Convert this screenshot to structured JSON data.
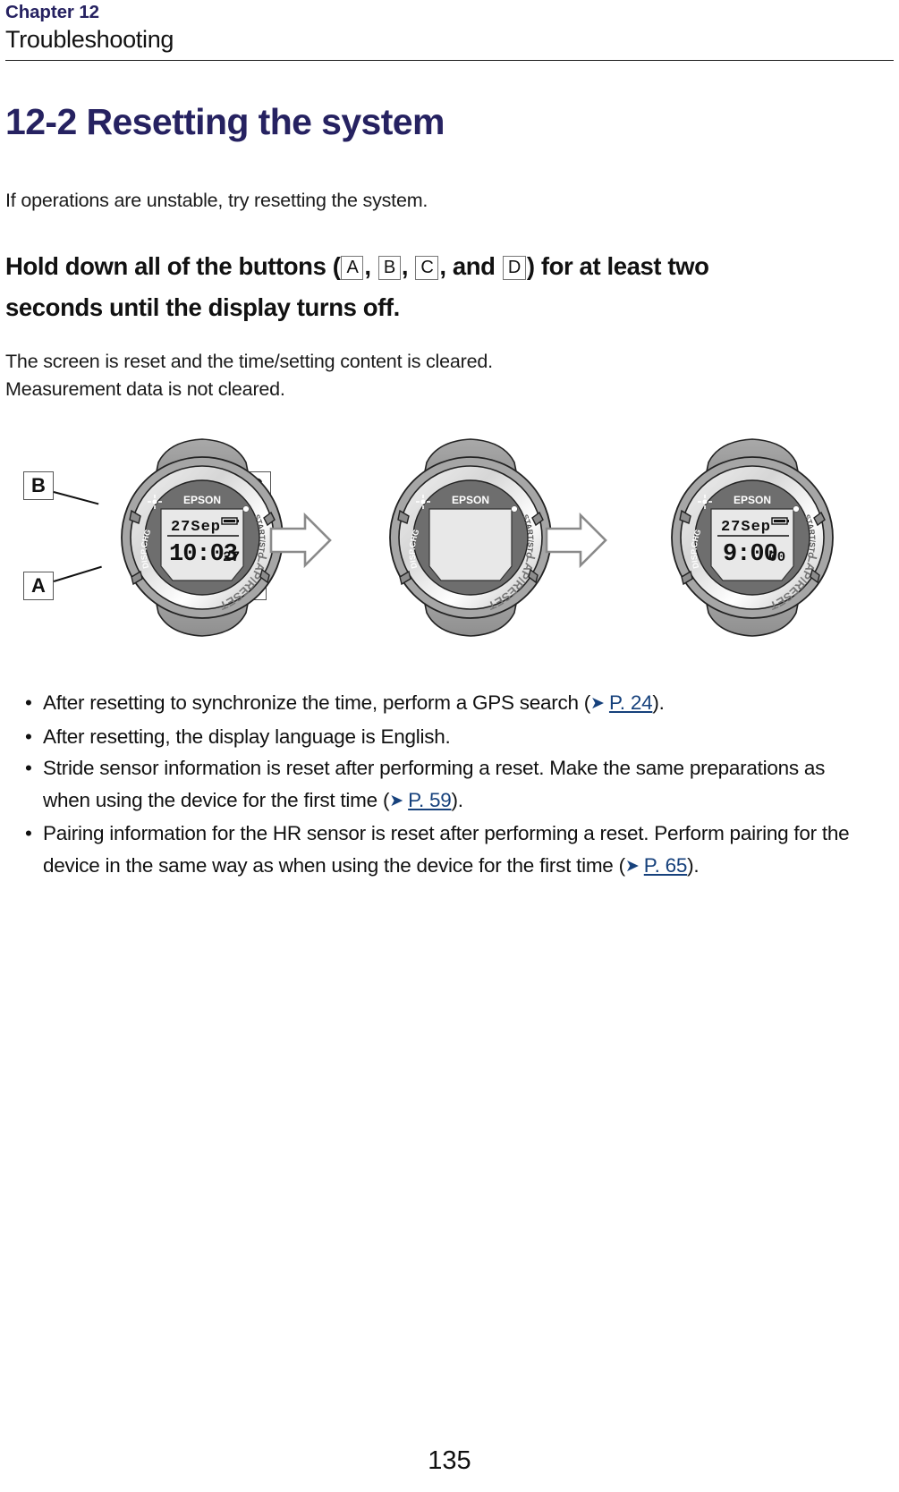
{
  "header": {
    "chapter_label": "Chapter 12",
    "chapter_title": "Troubleshooting"
  },
  "section": {
    "heading": "12-2 Resetting the system",
    "intro": "If operations are unstable, try resetting the system.",
    "instruction": {
      "part1": "Hold down all of the buttons (",
      "key_a": "A",
      "sep1": ", ",
      "key_b": "B",
      "sep2": ", ",
      "key_c": "C",
      "sep3": ", and ",
      "key_d": "D",
      "part2": ") for at least two seconds until the display turns off."
    },
    "result_line1": "The screen is reset and the time/setting content is cleared.",
    "result_line2": "Measurement data is not cleared."
  },
  "figure": {
    "callouts": {
      "b": "B",
      "c": "C",
      "a": "A",
      "d": "D"
    },
    "watches": [
      {
        "brand": "EPSON",
        "date": "27Sep",
        "time": "10:03",
        "seconds": "27",
        "display_on": true,
        "bezel_left": "DISP.CHG",
        "bezel_right_top": "START/STOP",
        "bezel_right_bottom": "LAP/RESET"
      },
      {
        "brand": "EPSON",
        "date": "",
        "time": "",
        "seconds": "",
        "display_on": false,
        "bezel_left": "DISP.CHG",
        "bezel_right_top": "START/STOP",
        "bezel_right_bottom": "LAP/RESET"
      },
      {
        "brand": "EPSON",
        "date": "27Sep",
        "time": "9:00",
        "seconds": "00",
        "display_on": true,
        "bezel_left": "DISP.CHG",
        "bezel_right_top": "START/STOP",
        "bezel_right_bottom": "LAP/RESET"
      }
    ]
  },
  "notes": [
    {
      "bullet": "•",
      "text_before": "After resetting to synchronize the time, perform a GPS search (",
      "link": "P. 24",
      "text_after": ")."
    },
    {
      "bullet": "•",
      "text_before": "After resetting, the display language is English.",
      "link": "",
      "text_after": ""
    },
    {
      "bullet": "•",
      "text_before": "Stride sensor information is reset after performing a reset. Make the same preparations as when using the device for the first time (",
      "link": "P. 59",
      "text_after": ")."
    },
    {
      "bullet": "•",
      "text_before": "Pairing information for the HR sensor is reset after performing a reset. Perform pairing for the device in the same way as when using the device for the first time (",
      "link": "P. 65",
      "text_after": ")."
    }
  ],
  "footer": {
    "page_number": "135"
  },
  "colors": {
    "heading_navy": "#262261",
    "link_blue": "#16417c",
    "body_black": "#111111"
  }
}
